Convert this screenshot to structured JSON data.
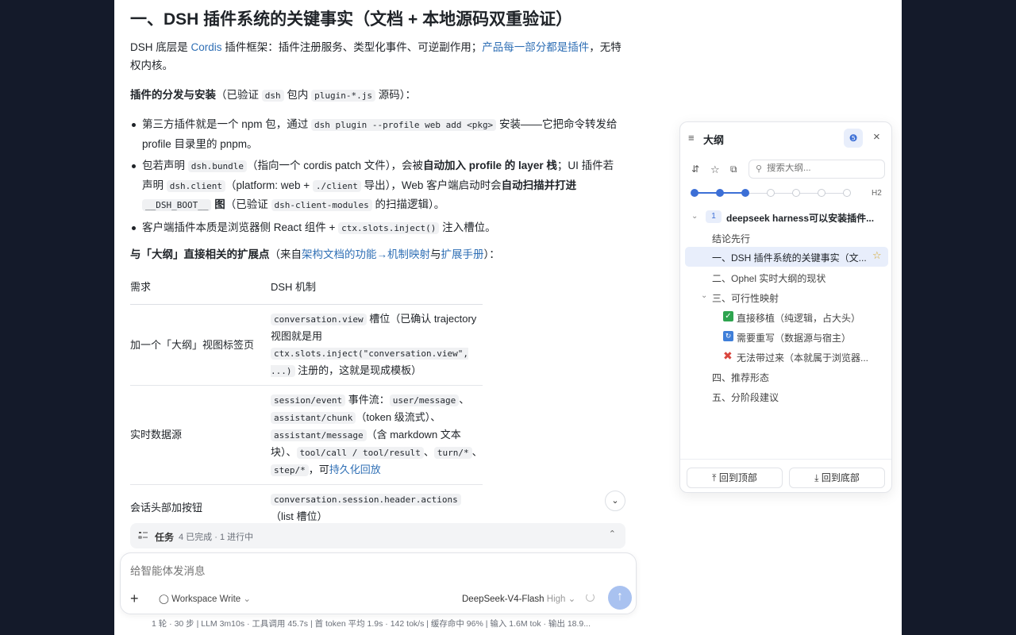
{
  "article": {
    "heading": "一、DSH 插件系统的关键事实（文档 + 本地源码双重验证）",
    "intro": {
      "pre": "DSH 底层是 ",
      "link1": "Cordis",
      "mid": " 插件框架：插件注册服务、类型化事件、可逆副作用；",
      "link2": "产品每一部分都是插件",
      "post": "，无特权内核。"
    },
    "dist": {
      "bold": "插件的分发与安装",
      "pre": "（已验证 ",
      "code1": "dsh",
      "mid": " 包内 ",
      "code2": "plugin-*.js",
      "post": " 源码）："
    },
    "bullets": {
      "b1_pre": "第三方插件就是一个 npm 包，通过 ",
      "b1_code": "dsh plugin --profile web add <pkg>",
      "b1_post": " 安装——它把命令转发给 profile 目录里的 pnpm。",
      "b2_a": "包若声明 ",
      "b2_code1": "dsh.bundle",
      "b2_b": "（指向一个 cordis patch 文件），会被",
      "b2_bold1": "自动加入 profile 的 layer 栈",
      "b2_c": "；UI 插件若声明 ",
      "b2_code2": "dsh.client",
      "b2_d": "（platform: web + ",
      "b2_code3": "./client",
      "b2_e": " 导出），Web 客户端启动时会",
      "b2_bold2": "自动扫描并打进 ",
      "b2_code4": "__DSH_BOOT__",
      "b2_bold3": " 图",
      "b2_f": "（已验证 ",
      "b2_code5": "dsh-client-modules",
      "b2_g": " 的扫描逻辑）。",
      "b3_pre": "客户端插件本质是浏览器侧 React 组件 + ",
      "b3_code": "ctx.slots.inject()",
      "b3_post": " 注入槽位。"
    },
    "ext": {
      "bold": "与「大纲」直接相关的扩展点",
      "pre": "（来自",
      "link1": "架构文档的功能→机制映射",
      "mid": "与",
      "link2": "扩展手册",
      "post": "）："
    },
    "table": {
      "headers": [
        "需求",
        "DSH 机制"
      ],
      "r1": {
        "need": "加一个「大纲」视图标签页",
        "code1": "conversation.view",
        "t1": " 槽位（已确认 trajectory 视图就是用 ",
        "code2": "ctx.slots.inject(\"conversation.view\", ...)",
        "t2": " 注册的，这就是现成模板）"
      },
      "r2": {
        "need": "实时数据源",
        "code1": "session/event",
        "t1": " 事件流：",
        "code2": "user/message",
        "t2": "、",
        "code3": "assistant/chunk",
        "t3": "（token 级流式）、",
        "code4": "assistant/message",
        "t4": "（含 markdown 文本块）、",
        "code5": "tool/call / tool/result",
        "t5": "、",
        "code6": "turn/*",
        "t6": "、",
        "code7": "step/*",
        "t7": "，可",
        "link": "持久化回放"
      },
      "r3": {
        "need": "会话头部加按钮",
        "code1": "conversation.session.header.actions",
        "t1": "（list 槽位）"
      }
    }
  },
  "task_bar": {
    "label": "任务",
    "status": "4 已完成 · 1 进行中"
  },
  "composer": {
    "placeholder": "给智能体发消息",
    "workspace": "Workspace Write",
    "model": "DeepSeek-V4-Flash",
    "effort": "High"
  },
  "status_line": "1 轮 · 30 步 | LLM 3m10s · 工具调用 45.7s | 首 token 平均 1.9s · 142 tok/s | 缓存命中 96% | 输入 1.6M tok · 输出 18.9...",
  "outline": {
    "title": "大纲",
    "search_placeholder": "搜索大纲...",
    "level_label": "H2",
    "level_selected": 3,
    "level_total": 7,
    "items": [
      {
        "number": "1",
        "label": "deepseek harness可以安装插件..."
      },
      {
        "label": "结论先行"
      },
      {
        "label": "一、DSH 插件系统的关键事实（文..."
      },
      {
        "label": "二、Ophel 实时大纲的现状"
      },
      {
        "label": "三、可行性映射"
      },
      {
        "label": "直接移植（纯逻辑，占大头）"
      },
      {
        "label": "需要重写（数据源与宿主）"
      },
      {
        "label": "无法带过来（本就属于浏览器..."
      },
      {
        "label": "四、推荐形态"
      },
      {
        "label": "五、分阶段建议"
      }
    ],
    "back_top": "回到顶部",
    "back_bottom": "回到底部"
  },
  "colors": {
    "accent": "#3c6fd6",
    "link": "#2f6fb5",
    "backdrop": "#141a2a",
    "send": "#a9c2f0"
  }
}
